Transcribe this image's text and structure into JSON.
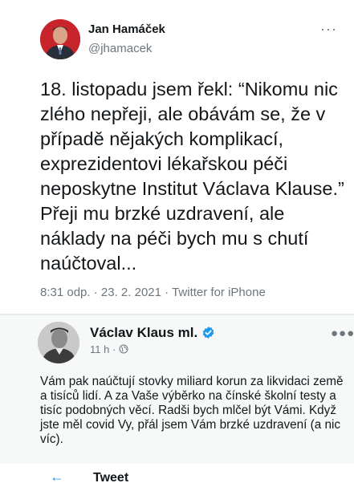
{
  "tweet_main": {
    "author_name": "Jan Hamáček",
    "handle": "@jhamacek",
    "body": "18. listopadu jsem řekl: “Nikomu nic zlého nepřeji, ale obávám se, že v případě nějakých komplikací, exprezidentovi lékařskou péči neposkytne Institut Václava Klause.” Přeji mu brzké uzdravení, ale náklady na péči bych mu s chutí naúčtoval...",
    "time": "8:31 odp.",
    "date": "23. 2. 2021",
    "source": "Twitter for iPhone",
    "separator": "·",
    "more_icon": "more-dots-icon"
  },
  "tweet_reply": {
    "author_name": "Václav Klaus ml.",
    "relative_time": "11 h",
    "separator": "·",
    "body": "Vám pak naúčtují stovky miliard korun za likvidaci země a tisíců lidí. A za Vaše výběrko na čínské školní testy a tisíc podobných věcí. Radši bych mlčel být Vámi. Když jste měl covid Vy, přál jsem Vám brzké uzdravení (a nic víc).",
    "verified_icon": "verified-badge-icon",
    "globe_icon": "globe-icon",
    "more_icon": "more-dots-icon"
  },
  "bottom_bar": {
    "title": "Tweet",
    "back_icon": "back-arrow-icon"
  },
  "colors": {
    "accent": "#1d9bf0",
    "secondary_text": "#6e767d",
    "reply_background": "#f7f9f9"
  }
}
